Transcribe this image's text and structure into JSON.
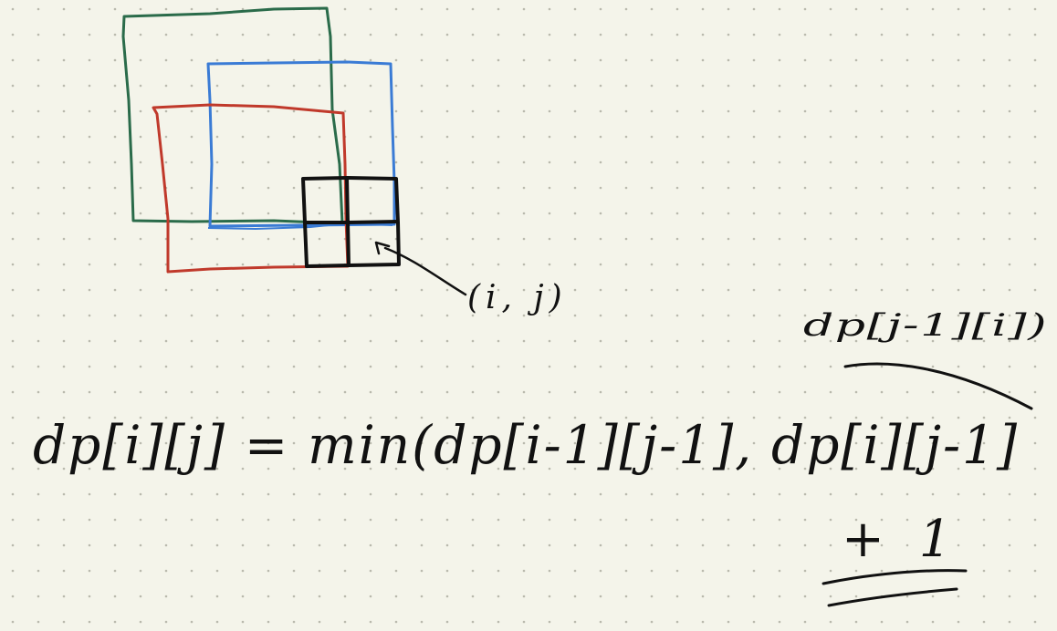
{
  "colors": {
    "background": "#f4f4ea",
    "dot_grid": "#b9b9ad",
    "ink": "#111111",
    "green_square": "#2a6b4a",
    "blue_square": "#3a7bd5",
    "red_square": "#c0392b"
  },
  "annotations": {
    "cell_label": "(i, j)",
    "top_right_term": "dp[j-1][i])",
    "recurrence": "dp[i][j] = min(dp[i-1][j-1], dp[i][j-1]",
    "plus_one": "+ 1"
  }
}
